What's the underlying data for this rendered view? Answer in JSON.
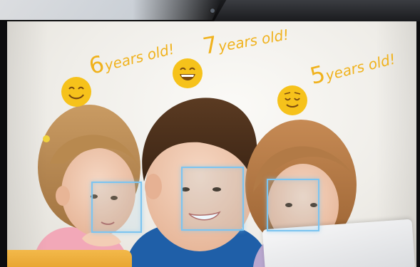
{
  "annotations": [
    {
      "label_number": "6",
      "label_text": "years old!",
      "emoji": "smiling-face-icon"
    },
    {
      "label_number": "7",
      "label_text": "years old!",
      "emoji": "grinning-face-icon"
    },
    {
      "label_number": "5",
      "label_text": "years old!",
      "emoji": "relieved-face-icon"
    }
  ],
  "colors": {
    "label": "#f0b21d",
    "emoji_face": "#f6c21b",
    "emoji_feature": "#7a4a10",
    "face_box": "#7cc4f0",
    "screen_background": "#efede8",
    "bezel": "#0d0d0f"
  }
}
